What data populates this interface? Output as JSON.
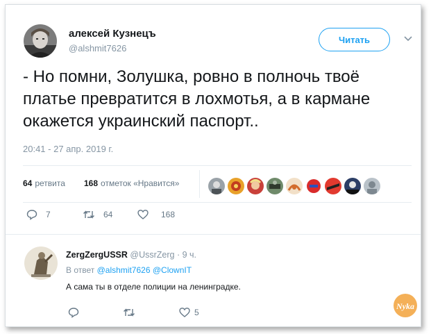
{
  "tweet": {
    "author_name": "алексей Кузнецъ",
    "author_handle": "@alshmit7626",
    "follow_label": "Читать",
    "text": "- Но помни, Золушка, ровно в полночь твоё платье превратится в лохмотья, а в кармане окажется украинский паспорт..",
    "timestamp": "20:41 - 27 апр. 2019 г."
  },
  "stats": {
    "retweets_count": "64",
    "retweets_label": "ретвита",
    "likes_count": "168",
    "likes_label": "отметок «Нравится»",
    "liker_avatars": [
      "avatar-1",
      "avatar-2",
      "avatar-3",
      "avatar-4",
      "avatar-5",
      "avatar-6",
      "avatar-7",
      "avatar-8",
      "avatar-9"
    ]
  },
  "actions": {
    "reply_count": "7",
    "retweet_count": "64",
    "like_count": "168"
  },
  "reply": {
    "author_name": "ZergZergUSSR",
    "author_handle": "@UssrZerg",
    "time": "· 9 ч.",
    "reply_to_prefix": "В ответ",
    "reply_to_users": [
      "@alshmit7626",
      "@ClownIT"
    ],
    "text": "А сама ты в отделе полиции на ленинградке.",
    "reply_count": "",
    "retweet_count": "",
    "like_count": "5"
  },
  "watermark_text": "Nyka",
  "colors": {
    "accent": "#1da1f2",
    "secondary_text": "#8595a3",
    "primary_text": "#14171a",
    "watermark": "#f2a23b"
  }
}
